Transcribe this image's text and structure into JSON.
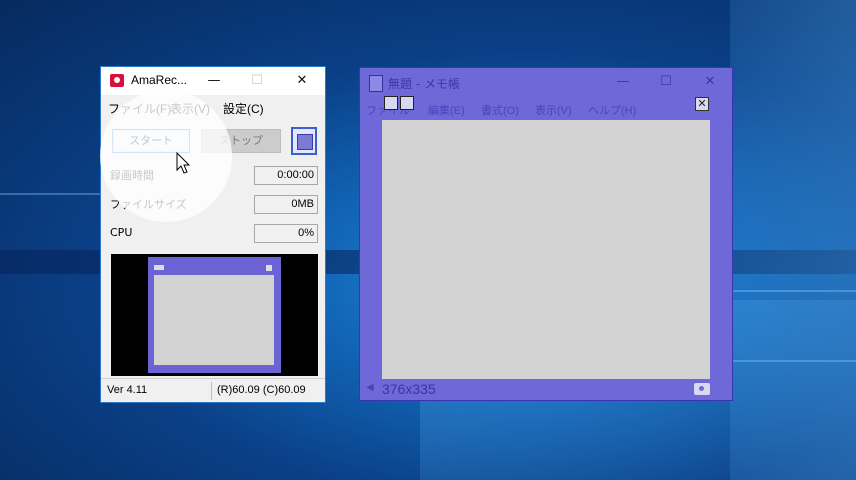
{
  "amarec": {
    "title": "AmaRec...",
    "menu": [
      "ファイル(F)",
      "表示(V)",
      "設定(C)"
    ],
    "buttons": {
      "start": "スタート",
      "stop": "ストップ"
    },
    "fields": [
      {
        "label": "録画時間",
        "value": "0:00:00"
      },
      {
        "label": "ファイルサイズ",
        "value": "0MB"
      },
      {
        "label": "CPU",
        "value": "0%"
      }
    ],
    "status": {
      "version": "Ver 4.11",
      "rates": "(R)60.09 (C)60.09"
    }
  },
  "notepad": {
    "title": "無題 - メモ帳",
    "menu": [
      "ファイル",
      "編集(E)",
      "書式(O)",
      "表示(V)",
      "ヘルプ(H)"
    ],
    "capture_size": "376x335"
  },
  "window_controls": {
    "minimize": "—",
    "maximize": "☐",
    "close": "✕"
  },
  "colors": {
    "capture_overlay": "#6f68d8",
    "start_button_border": "#3c8ad9",
    "app_icon": "#d8113a"
  }
}
